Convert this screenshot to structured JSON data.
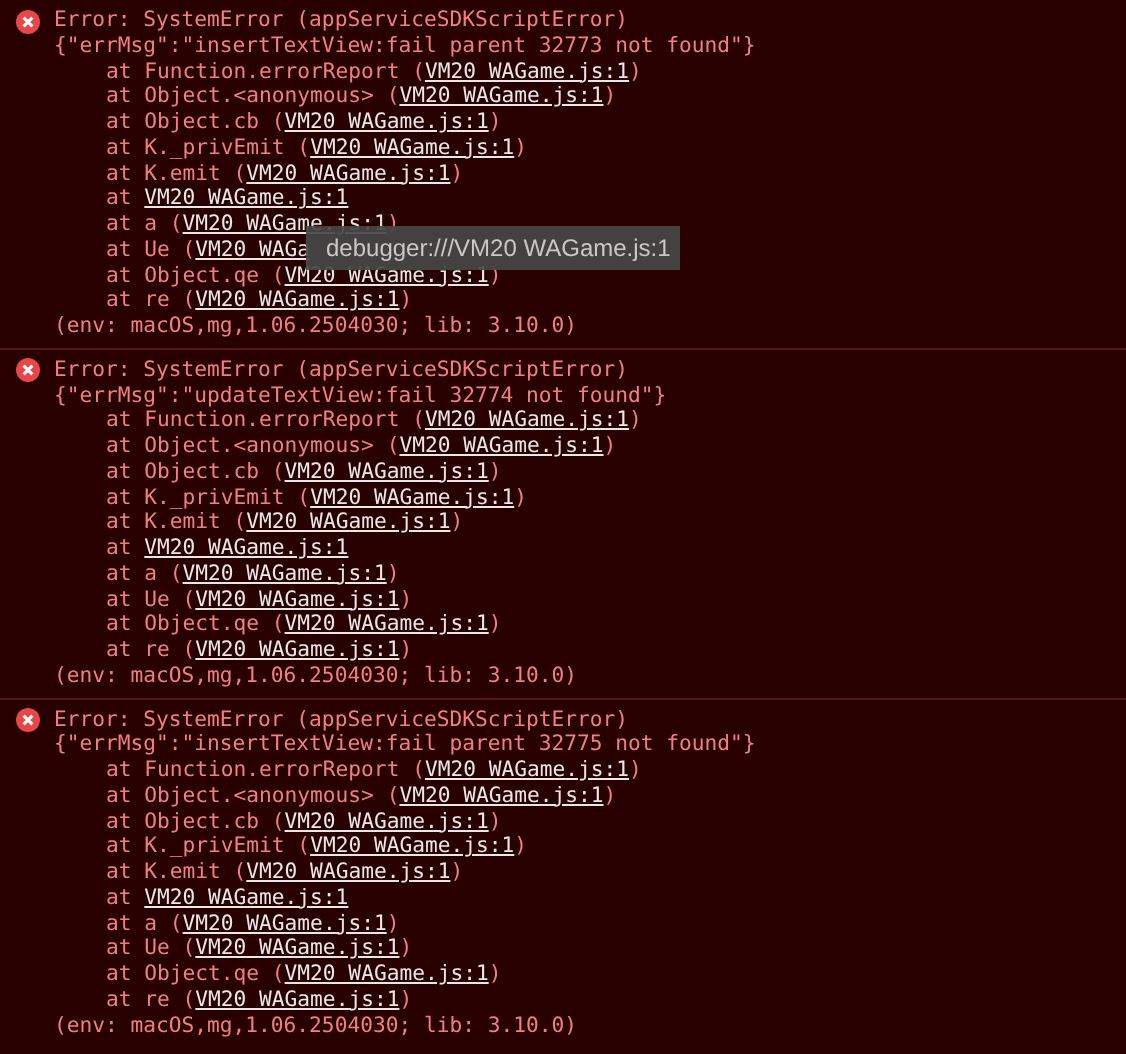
{
  "errors": [
    {
      "title": "Error: SystemError (appServiceSDKScriptError)",
      "message": "{\"errMsg\":\"insertTextView:fail parent 32773 not found\"}",
      "frames": [
        {
          "prefix": "at Function.errorReport (",
          "link": "VM20 WAGame.js:1",
          "suffix": ")"
        },
        {
          "prefix": "at Object.<anonymous> (",
          "link": "VM20 WAGame.js:1",
          "suffix": ")"
        },
        {
          "prefix": "at Object.cb (",
          "link": "VM20 WAGame.js:1",
          "suffix": ")"
        },
        {
          "prefix": "at K._privEmit (",
          "link": "VM20 WAGame.js:1",
          "suffix": ")"
        },
        {
          "prefix": "at K.emit (",
          "link": "VM20 WAGame.js:1",
          "suffix": ")"
        },
        {
          "prefix": "at ",
          "link": "VM20 WAGame.js:1"
        },
        {
          "prefix": "at a (",
          "link": "VM20 WAGame.js:1",
          "suffix": ")"
        },
        {
          "prefix": "at Ue (",
          "link": "VM20 WAGa"
        },
        {
          "prefix": "at Object.qe (",
          "link": "VM20 WAGame.js:1",
          "suffix": ")"
        },
        {
          "prefix": "at re (",
          "link": "VM20 WAGame.js:1",
          "suffix": ")"
        }
      ],
      "env": "(env: macOS,mg,1.06.2504030; lib: 3.10.0)",
      "tooltip": "debugger:///VM20 WAGame.js:1"
    },
    {
      "title": "Error: SystemError (appServiceSDKScriptError)",
      "message": "{\"errMsg\":\"updateTextView:fail 32774 not found\"}",
      "frames": [
        {
          "prefix": "at Function.errorReport (",
          "link": "VM20 WAGame.js:1",
          "suffix": ")"
        },
        {
          "prefix": "at Object.<anonymous> (",
          "link": "VM20 WAGame.js:1",
          "suffix": ")"
        },
        {
          "prefix": "at Object.cb (",
          "link": "VM20 WAGame.js:1",
          "suffix": ")"
        },
        {
          "prefix": "at K._privEmit (",
          "link": "VM20 WAGame.js:1",
          "suffix": ")"
        },
        {
          "prefix": "at K.emit (",
          "link": "VM20 WAGame.js:1",
          "suffix": ")"
        },
        {
          "prefix": "at ",
          "link": "VM20 WAGame.js:1"
        },
        {
          "prefix": "at a (",
          "link": "VM20 WAGame.js:1",
          "suffix": ")"
        },
        {
          "prefix": "at Ue (",
          "link": "VM20 WAGame.js:1",
          "suffix": ")"
        },
        {
          "prefix": "at Object.qe (",
          "link": "VM20 WAGame.js:1",
          "suffix": ")"
        },
        {
          "prefix": "at re (",
          "link": "VM20 WAGame.js:1",
          "suffix": ")"
        }
      ],
      "env": "(env: macOS,mg,1.06.2504030; lib: 3.10.0)"
    },
    {
      "title": "Error: SystemError (appServiceSDKScriptError)",
      "message": "{\"errMsg\":\"insertTextView:fail parent 32775 not found\"}",
      "frames": [
        {
          "prefix": "at Function.errorReport (",
          "link": "VM20 WAGame.js:1",
          "suffix": ")"
        },
        {
          "prefix": "at Object.<anonymous> (",
          "link": "VM20 WAGame.js:1",
          "suffix": ")"
        },
        {
          "prefix": "at Object.cb (",
          "link": "VM20 WAGame.js:1",
          "suffix": ")"
        },
        {
          "prefix": "at K._privEmit (",
          "link": "VM20 WAGame.js:1",
          "suffix": ")"
        },
        {
          "prefix": "at K.emit (",
          "link": "VM20 WAGame.js:1",
          "suffix": ")"
        },
        {
          "prefix": "at ",
          "link": "VM20 WAGame.js:1"
        },
        {
          "prefix": "at a (",
          "link": "VM20 WAGame.js:1",
          "suffix": ")"
        },
        {
          "prefix": "at Ue (",
          "link": "VM20 WAGame.js:1",
          "suffix": ")"
        },
        {
          "prefix": "at Object.qe (",
          "link": "VM20 WAGame.js:1",
          "suffix": ")"
        },
        {
          "prefix": "at re (",
          "link": "VM20 WAGame.js:1",
          "suffix": ")"
        }
      ],
      "env": "(env: macOS,mg,1.06.2504030; lib: 3.10.0)"
    }
  ]
}
